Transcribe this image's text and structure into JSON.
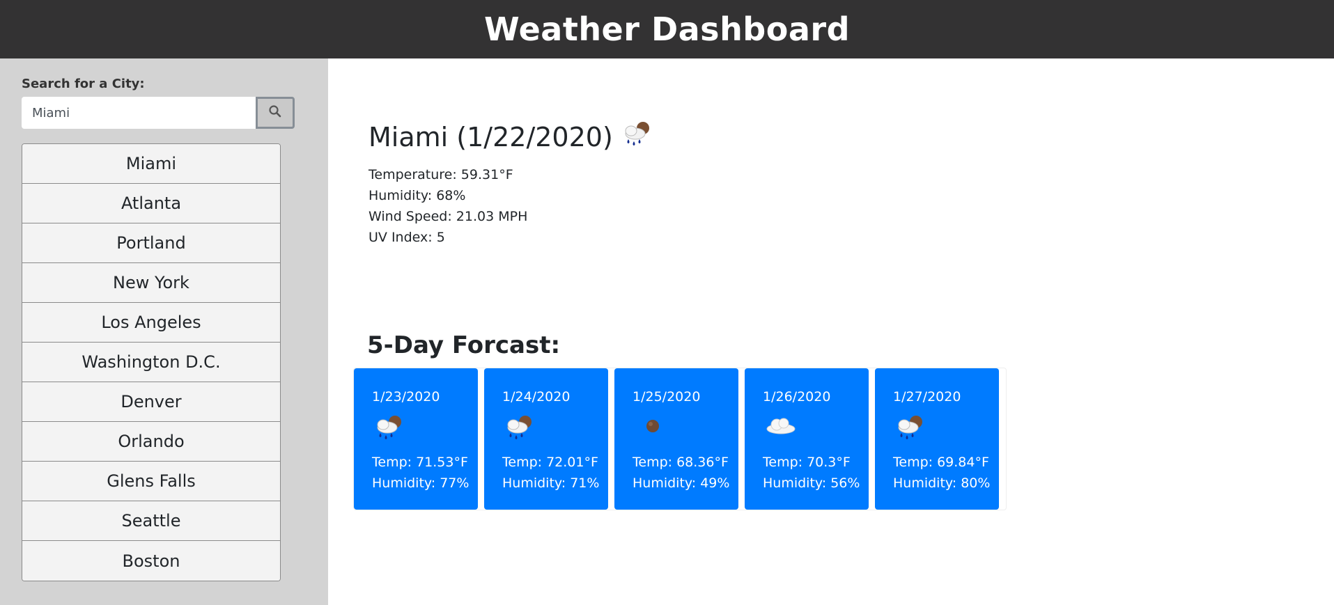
{
  "app": {
    "title": "Weather Dashboard"
  },
  "sidebar": {
    "search_label": "Search for a City:",
    "search_value": "Miami",
    "cities": [
      "Miami",
      "Atlanta",
      "Portland",
      "New York",
      "Los Angeles",
      "Washington D.C.",
      "Denver",
      "Orlando",
      "Glens Falls",
      "Seattle",
      "Boston"
    ]
  },
  "current": {
    "title": "Miami (1/22/2020)",
    "icon": "rain-icon",
    "temperature": "Temperature: 59.31°F",
    "humidity": "Humidity: 68%",
    "wind": "Wind Speed: 21.03 MPH",
    "uv": "UV Index: 5"
  },
  "forecast": {
    "heading": "5-Day Forcast:",
    "days": [
      {
        "date": "1/23/2020",
        "icon": "rain-icon",
        "temp": "Temp: 71.53°F",
        "humidity": "Humidity: 77%"
      },
      {
        "date": "1/24/2020",
        "icon": "rain-icon",
        "temp": "Temp: 72.01°F",
        "humidity": "Humidity: 71%"
      },
      {
        "date": "1/25/2020",
        "icon": "night-clear-icon",
        "temp": "Temp: 68.36°F",
        "humidity": "Humidity: 49%"
      },
      {
        "date": "1/26/2020",
        "icon": "cloud-icon",
        "temp": "Temp: 70.3°F",
        "humidity": "Humidity: 56%"
      },
      {
        "date": "1/27/2020",
        "icon": "rain-icon",
        "temp": "Temp: 69.84°F",
        "humidity": "Humidity: 80%"
      }
    ]
  },
  "colors": {
    "header_bg": "#333233",
    "card_bg": "#007bff",
    "sidebar_bg": "#d3d3d3"
  }
}
